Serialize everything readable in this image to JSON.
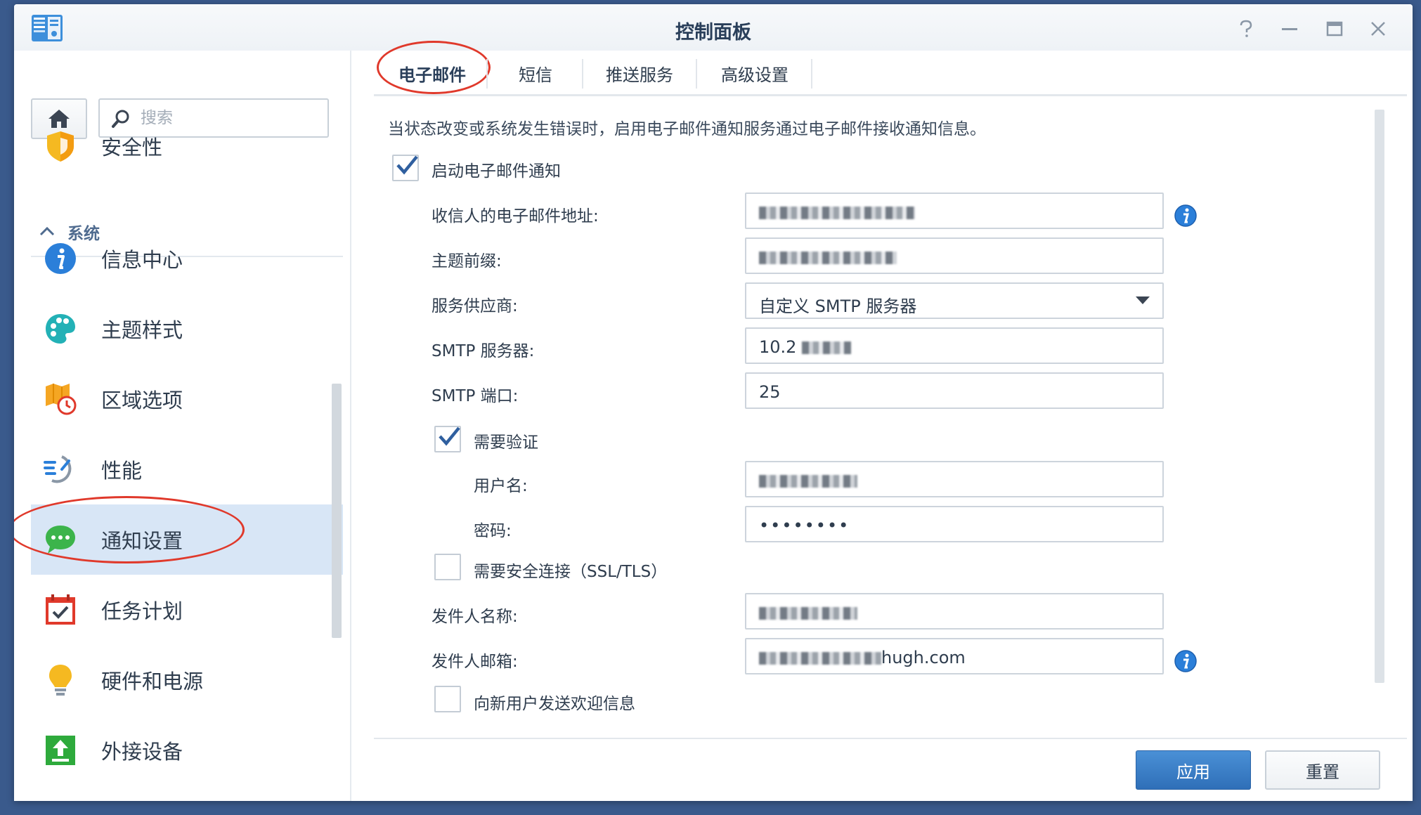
{
  "window": {
    "title": "控制面板"
  },
  "sidebar": {
    "search_placeholder": "搜索",
    "security_label": "安全性",
    "section_label": "系统",
    "items": [
      {
        "label": "信息中心",
        "icon": "info-icon"
      },
      {
        "label": "主题样式",
        "icon": "palette-icon"
      },
      {
        "label": "区域选项",
        "icon": "region-clock-icon"
      },
      {
        "label": "性能",
        "icon": "performance-icon"
      },
      {
        "label": "通知设置",
        "icon": "notification-chat-icon",
        "selected": true
      },
      {
        "label": "任务计划",
        "icon": "calendar-task-icon"
      },
      {
        "label": "硬件和电源",
        "icon": "lightbulb-icon"
      },
      {
        "label": "外接设备",
        "icon": "external-device-icon"
      }
    ]
  },
  "tabs": [
    {
      "label": "电子邮件",
      "active": true
    },
    {
      "label": "短信"
    },
    {
      "label": "推送服务"
    },
    {
      "label": "高级设置"
    }
  ],
  "email": {
    "description": "当状态改变或系统发生错误时，启用电子邮件通知服务通过电子邮件接收通知信息。",
    "enable_label": "启动电子邮件通知",
    "enable_checked": true,
    "recipient_label": "收信人的电子邮件地址:",
    "subject_label": "主题前缀:",
    "provider_label": "服务供应商:",
    "provider_value": "自定义 SMTP 服务器",
    "smtp_server_label": "SMTP 服务器:",
    "smtp_server_value": "10.2",
    "smtp_port_label": "SMTP 端口:",
    "smtp_port_value": "25",
    "auth_label": "需要验证",
    "auth_checked": true,
    "username_label": "用户名:",
    "password_label": "密码:",
    "password_value": "••••••••",
    "ssl_label": "需要安全连接（SSL/TLS）",
    "ssl_checked": false,
    "sender_name_label": "发件人名称:",
    "sender_email_label": "发件人邮箱:",
    "sender_email_value": "hugh.com",
    "welcome_label": "向新用户发送欢迎信息",
    "welcome_checked": false
  },
  "buttons": {
    "apply": "应用",
    "reset": "重置"
  },
  "colors": {
    "accent": "#2f6fb8",
    "selected_bg": "#d8e6f6",
    "annotation": "#e0392b"
  }
}
